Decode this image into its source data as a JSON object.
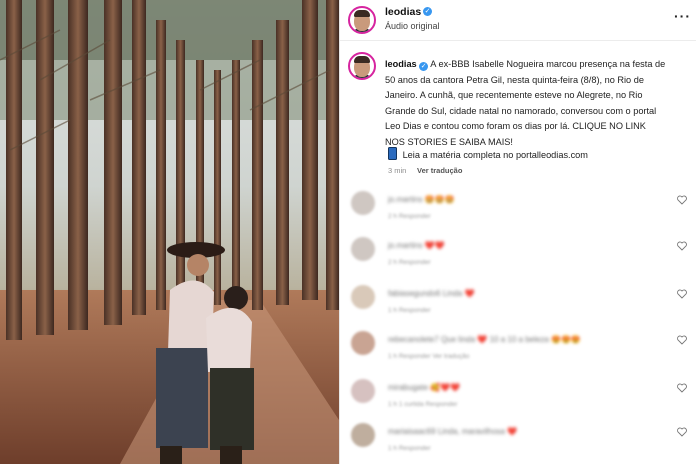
{
  "post": {
    "username": "leodias",
    "audio": "Áudio original",
    "caption_username": "leodias",
    "caption_text": "A ex-BBB Isabelle Nogueira marcou presença na festa de 50 anos da cantora Petra Gil, nesta quinta-feira (8/8), no Rio de Janeiro. A cunhã, que recentemente esteve no Alegrete, no Rio Grande do Sul, cidade natal no namorado, conversou com o portal Leo Dias e contou como foram os dias por lá. CLIQUE NO LINK NOS STORIES E SAIBA MAIS!",
    "link_text": "Leia a matéria completa no portalleodias.com",
    "time_ago": "3 min",
    "translate": "Ver tradução"
  },
  "comments": [
    {
      "user": "jo.martins",
      "text": "🤩🤩🤩",
      "meta": "2 h   Responder"
    },
    {
      "user": "jo.martins",
      "text": "❤️❤️",
      "meta": "2 h   Responder"
    },
    {
      "user": "fabiasegundo6",
      "text": "Linda ❤️",
      "meta": "1 h   Responder"
    },
    {
      "user": "rebecanolete7",
      "text": "Que linda ❤️ 10 a 10 a beleza 😍😍😍",
      "meta": "1 h   Responder   Ver tradução"
    },
    {
      "user": "mirabugate",
      "text": "🥰❤️❤️",
      "meta": "1 h   1 curtida   Responder"
    },
    {
      "user": "mariaisaac69",
      "text": "Linda, maravilhosa ❤️",
      "meta": "1 h   Responder"
    }
  ],
  "icons": {
    "more": "more-options-icon",
    "verified": "verified-badge-icon",
    "phone": "phone-icon",
    "heart": "heart-icon"
  }
}
